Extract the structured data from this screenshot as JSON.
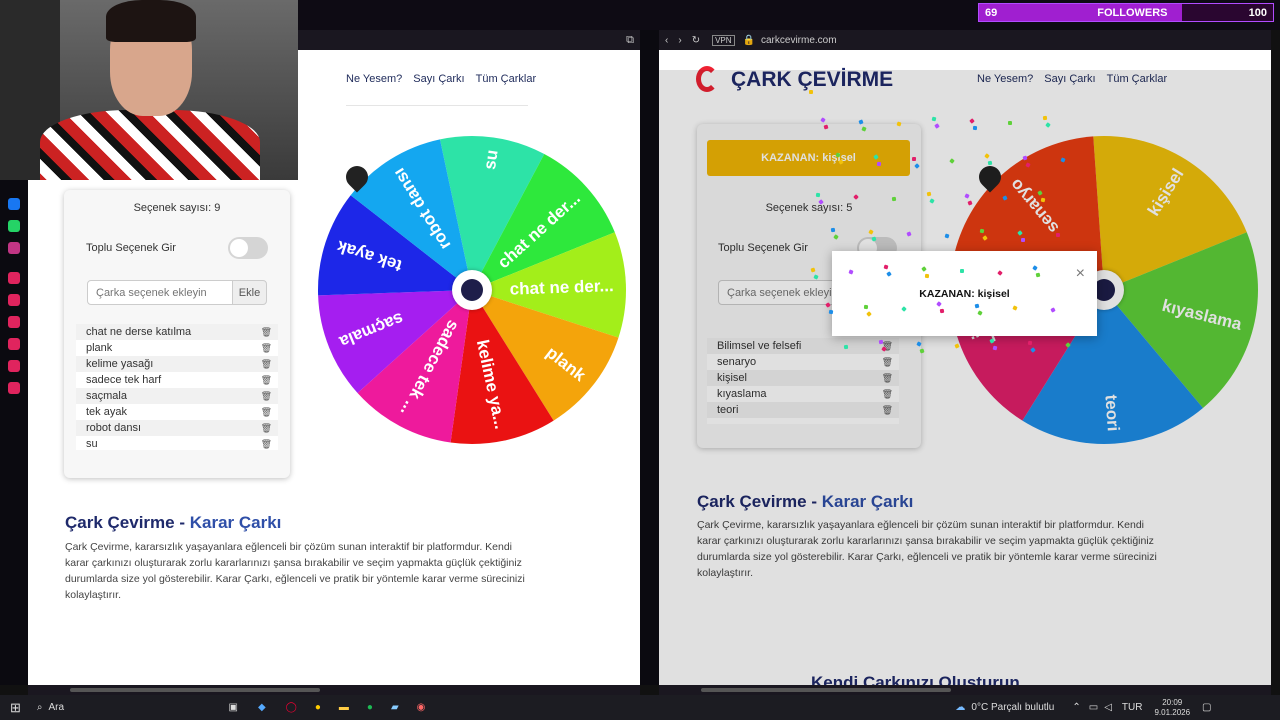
{
  "stream": {
    "followers_count": "69",
    "followers_label": "FOLLOWERS",
    "followers_goal": "100",
    "followers_progress": 0.69
  },
  "browser_right": {
    "url": "carkcevirme.com",
    "vpn": "VPN"
  },
  "site": {
    "logo_text": "ÇARK ÇEVİRME",
    "nav": [
      "Ne Yesem?",
      "Sayı Çarkı",
      "Tüm Çarklar"
    ],
    "toggle_label": "Toplu Seçenek Gir",
    "input_placeholder": "Çarka seçenek ekleyin",
    "add_button": "Ekle",
    "heading_main": "Çark Çevirme - ",
    "heading_accent": "Karar Çarkı",
    "paragraph": "Çark Çevirme, kararsızlık yaşayanlara eğlenceli bir çözüm sunan interaktif bir platformdur. Kendi karar çarkınızı oluşturarak zorlu kararlarınızı şansa bırakabilir ve seçim yapmakta güçlük çektiğiniz durumlarda size yol gösterebilir. Karar Çarkı, eğlenceli ve pratik bir yöntemle karar verme sürecinizi kolaylaştırır.",
    "next_heading_partial": "Kendi Çarkınızı Oluşturun"
  },
  "left": {
    "count_text": "Seçenek sayısı: 9",
    "options": [
      "chat ne derse katılma",
      "plank",
      "kelime yasağı",
      "sadece tek harf",
      "saçmala",
      "tek ayak",
      "robot dansı",
      "su"
    ],
    "wheel_labels": [
      "su",
      "chat ne der...",
      "chat ne der...",
      "plank",
      "kelime ya...",
      "sadece tek ...",
      "saçmala",
      "tek ayak",
      "robot dansı"
    ],
    "wheel_colors": [
      "#2de3a7",
      "#2ee83c",
      "#a3ee1a",
      "#f4a40b",
      "#ea1212",
      "#ee1a9c",
      "#a51ef0",
      "#1d27e8",
      "#14a7f0"
    ]
  },
  "right": {
    "winner_banner": "KAZANAN: kişisel",
    "count_text": "Seçenek sayısı: 5",
    "options": [
      "Bilimsel ve felsefi",
      "senaryo",
      "kişisel",
      "kıyaslama",
      "teori"
    ],
    "wheel_labels": [
      "kişisel",
      "kıyaslama",
      "teori",
      "Bilimsel ...",
      "senaryo"
    ],
    "wheel_colors": [
      "#f2c20b",
      "#5fd13a",
      "#1d8ee8",
      "#e21f6a",
      "#ea3d12"
    ],
    "modal_text": "KAZANAN: kişisel",
    "modal_close": "×"
  },
  "taskbar": {
    "search": "Ara",
    "weather": "0°C  Parçalı bulutlu",
    "lang": "TUR",
    "time": "20:09",
    "date": "9.01.2026"
  }
}
